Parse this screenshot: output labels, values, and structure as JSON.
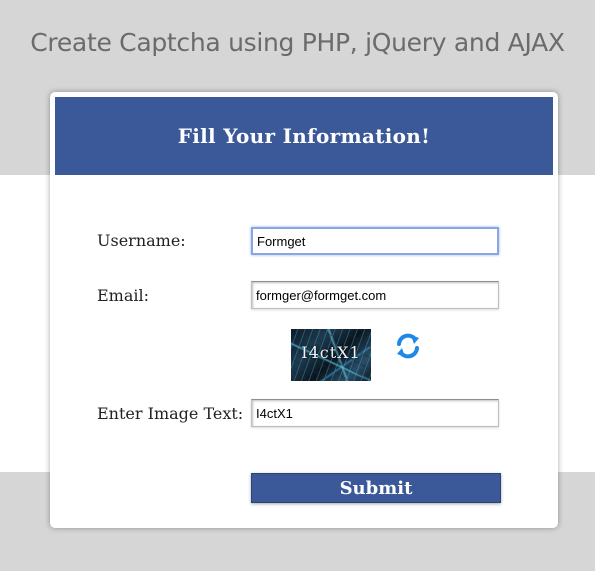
{
  "page": {
    "title": "Create Captcha using PHP, jQuery and AJAX"
  },
  "form": {
    "header": "Fill Your Information!",
    "username": {
      "label": "Username:",
      "value": "Formget"
    },
    "email": {
      "label": "Email:",
      "value": "formger@formget.com"
    },
    "captcha": {
      "image_text": "I4ctX1",
      "refresh_icon": "refresh-icon"
    },
    "image_text": {
      "label": "Enter Image Text:",
      "value": "I4ctX1"
    },
    "submit_label": "Submit"
  },
  "colors": {
    "accent": "#3b5998",
    "background": "#d6d6d6",
    "refresh": "#1e88e5"
  }
}
